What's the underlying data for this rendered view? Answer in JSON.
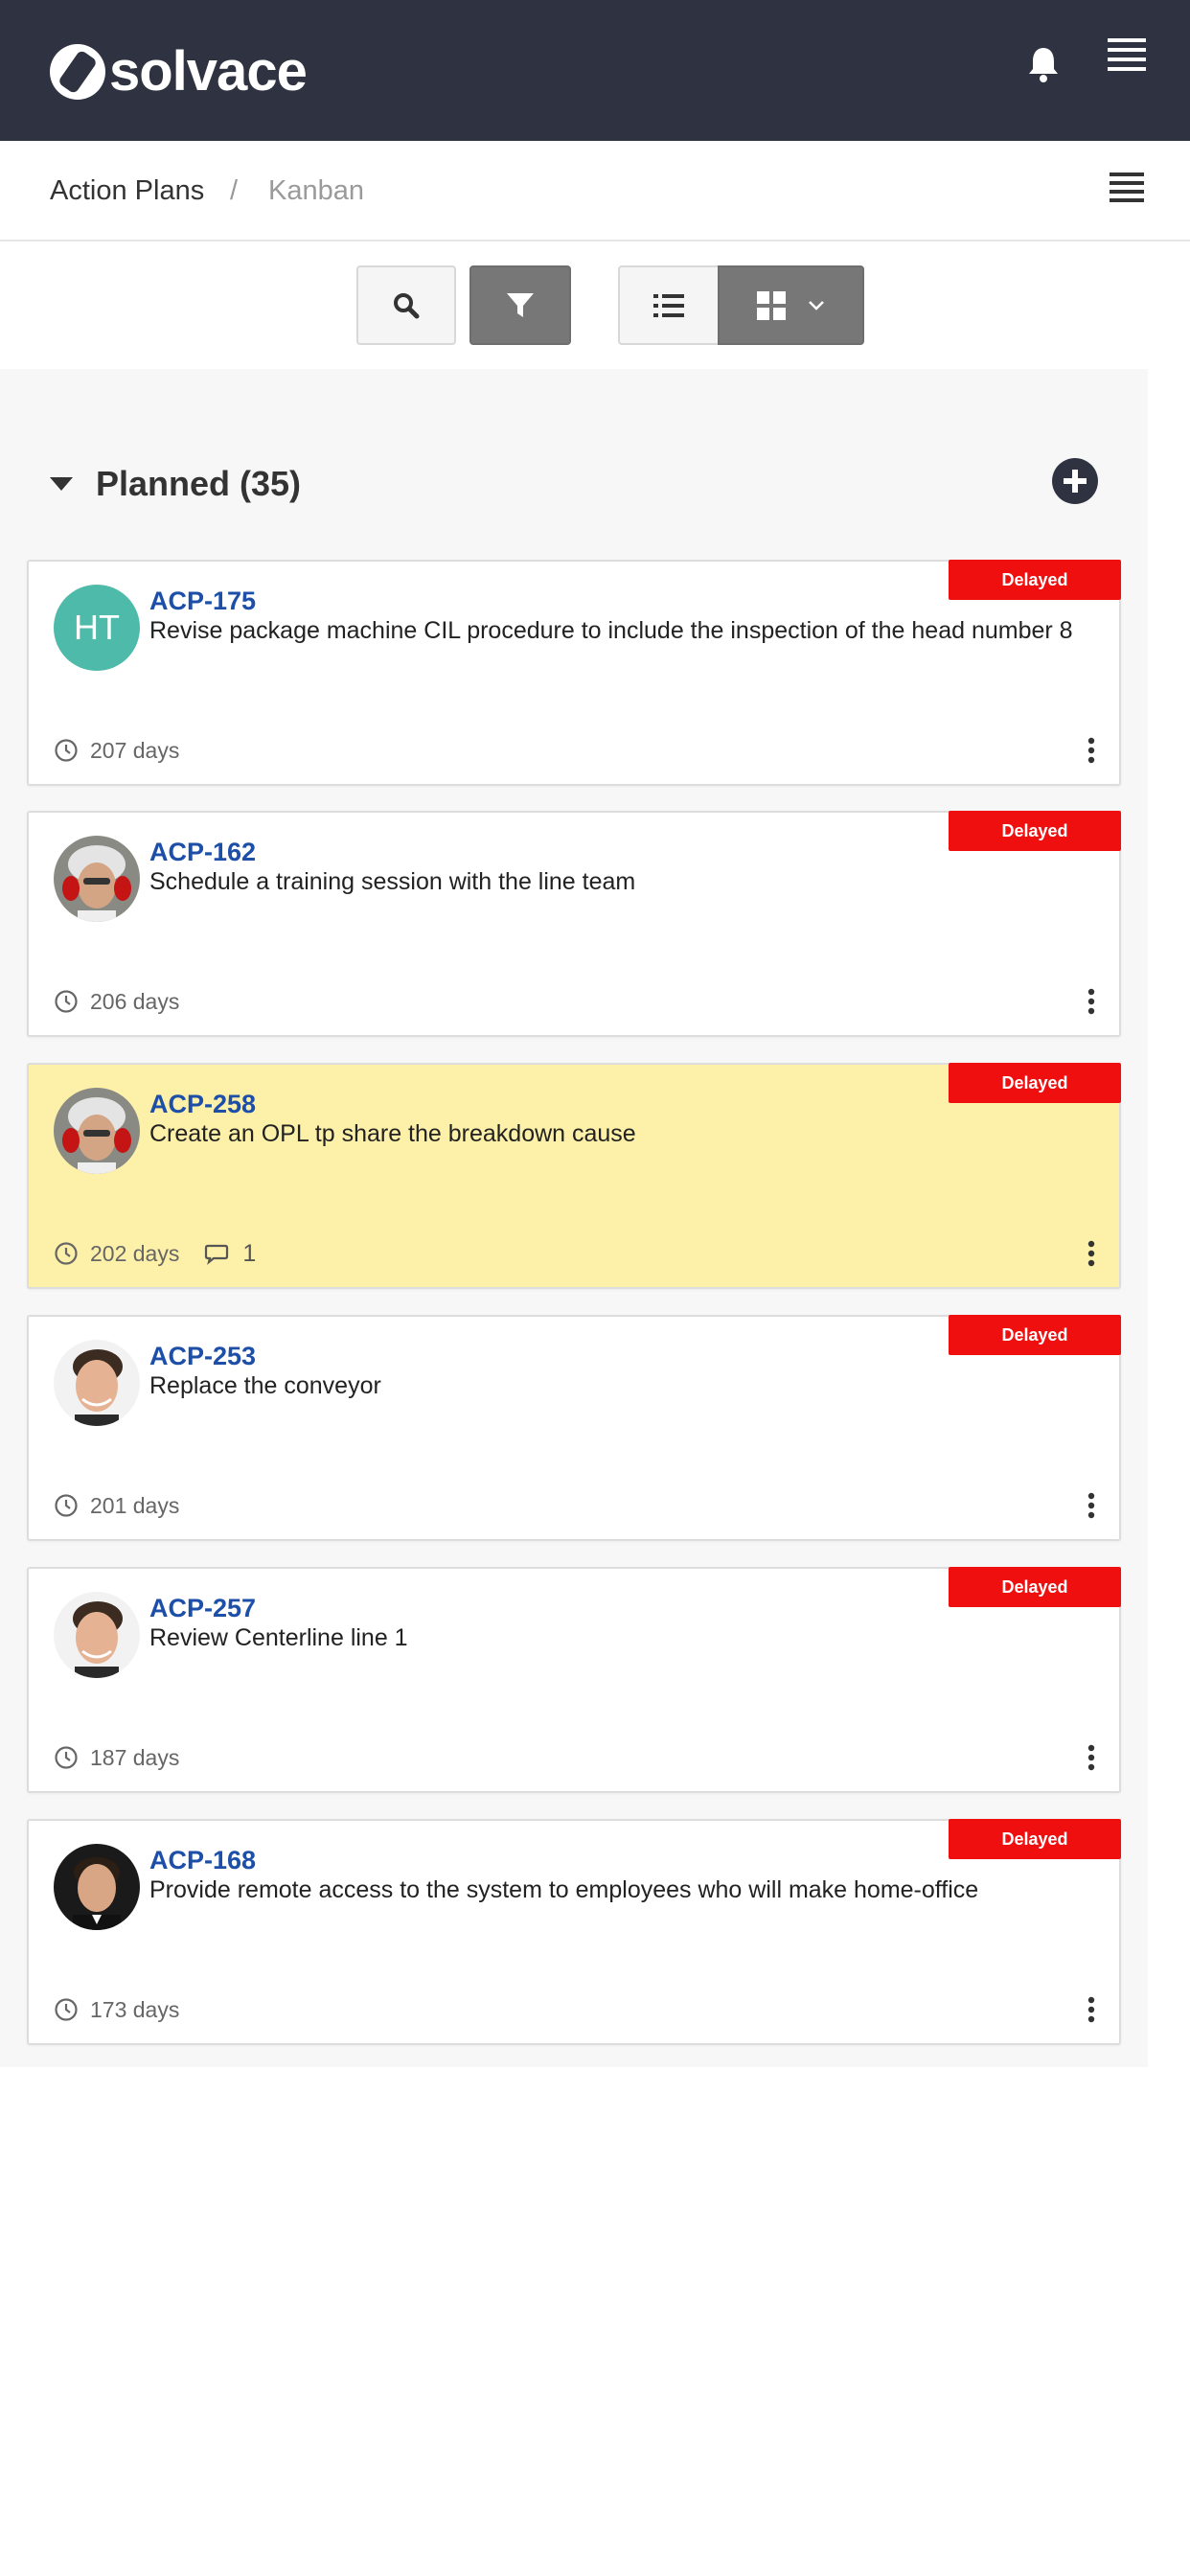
{
  "app": {
    "brand": "solvace",
    "header_color": "#2f3240"
  },
  "icons": {
    "notifications": "bell-icon",
    "menu": "hamburger-icon"
  },
  "breadcrumb": {
    "items": [
      "Action Plans",
      "Kanban"
    ],
    "separator": "/"
  },
  "toolbar": {
    "search": "search-icon",
    "filter": "filter-icon",
    "list_view": "list-icon",
    "grid_view": "grid-icon",
    "active_color": "#777777"
  },
  "column": {
    "title": "Planned (35)"
  },
  "status_color": "#ef0f0f",
  "highlight_color": "#fdf0a8",
  "cards": [
    {
      "id": "ACP-175",
      "description": "Revise package machine CIL procedure to include the inspection of the head number 8",
      "status": "Delayed",
      "age": "207 days",
      "avatar": "HT",
      "comments": ""
    },
    {
      "id": "ACP-162",
      "description": "Schedule a training session with the line team",
      "status": "Delayed",
      "age": "206 days",
      "avatar": "",
      "comments": ""
    },
    {
      "id": "ACP-258",
      "description": "Create an OPL tp share the breakdown cause",
      "status": "Delayed",
      "age": "202 days",
      "avatar": "",
      "comments": "1"
    },
    {
      "id": "ACP-253",
      "description": "Replace the conveyor",
      "status": "Delayed",
      "age": "201 days",
      "avatar": "",
      "comments": ""
    },
    {
      "id": "ACP-257",
      "description": "Review Centerline line 1",
      "status": "Delayed",
      "age": "187 days",
      "avatar": "",
      "comments": ""
    },
    {
      "id": "ACP-168",
      "description": "Provide remote access to the system to employees who will make home-office",
      "status": "Delayed",
      "age": "173 days",
      "avatar": "",
      "comments": ""
    }
  ]
}
